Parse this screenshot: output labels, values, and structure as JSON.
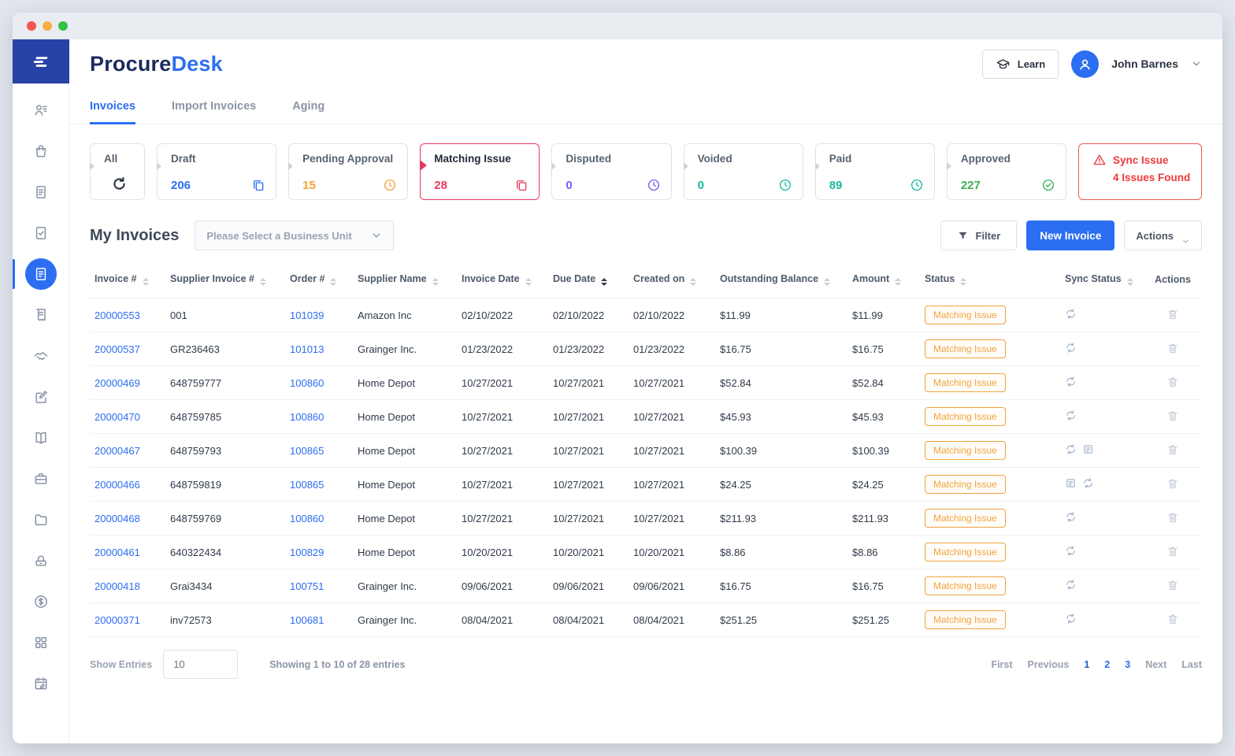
{
  "colors": {
    "accent_blue": "#2c6ef2",
    "badge_orange": "#f2a23c",
    "alert_red": "#ee3b3b",
    "selected_pink": "#e8395f",
    "sidebar_logo_bg": "#2742a6",
    "traffic_lights": [
      "#f4564e",
      "#f5b041",
      "#33c148"
    ]
  },
  "brand": {
    "logo_part1": "Procure",
    "logo_part2": "Desk"
  },
  "header": {
    "learn_label": "Learn",
    "user_name": "John Barnes"
  },
  "sidebar": {
    "items": [
      {
        "icon": "users-icon",
        "active": false
      },
      {
        "icon": "shopping-bag-icon",
        "active": false
      },
      {
        "icon": "purchase-order-icon",
        "active": false
      },
      {
        "icon": "document-check-icon",
        "active": false
      },
      {
        "icon": "invoices-icon",
        "active": true
      },
      {
        "icon": "receipt-icon",
        "active": false
      },
      {
        "icon": "handshake-icon",
        "active": false
      },
      {
        "icon": "document-edit-icon",
        "active": false
      },
      {
        "icon": "catalog-icon",
        "active": false
      },
      {
        "icon": "toolbox-icon",
        "active": false
      },
      {
        "icon": "folder-icon",
        "active": false
      },
      {
        "icon": "scale-icon",
        "active": false
      },
      {
        "icon": "currency-icon",
        "active": false
      },
      {
        "icon": "apps-grid-icon",
        "active": false
      },
      {
        "icon": "calendar-edit-icon",
        "active": false
      }
    ]
  },
  "tabs": [
    {
      "label": "Invoices",
      "active": true
    },
    {
      "label": "Import Invoices",
      "active": false
    },
    {
      "label": "Aging",
      "active": false
    }
  ],
  "status_cards": [
    {
      "label": "All",
      "type": "all",
      "icon": "refresh-icon",
      "color": "#2b3440"
    },
    {
      "label": "Draft",
      "count": "206",
      "icon": "copy-icon",
      "color": "#2c6ef2"
    },
    {
      "label": "Pending Approval",
      "count": "15",
      "icon": "clock-icon",
      "color": "#f2a23c"
    },
    {
      "label": "Matching Issue",
      "count": "28",
      "icon": "copy-icon",
      "color": "#e8395f",
      "selected": true
    },
    {
      "label": "Disputed",
      "count": "0",
      "icon": "clock-icon",
      "color": "#7a5af8"
    },
    {
      "label": "Voided",
      "count": "0",
      "icon": "clock-icon",
      "color": "#1db9a0"
    },
    {
      "label": "Paid",
      "count": "89",
      "icon": "clock-icon",
      "color": "#1db9a0"
    },
    {
      "label": "Approved",
      "count": "227",
      "icon": "check-circle-icon",
      "color": "#3bb059"
    },
    {
      "label": "Sync Issue",
      "type": "alert",
      "sub": "4 Issues Found",
      "icon": "warning-icon",
      "color": "#ee3b3b"
    }
  ],
  "toolbar": {
    "title": "My Invoices",
    "business_unit_placeholder": "Please Select a Business Unit",
    "filter_label": "Filter",
    "new_invoice_label": "New Invoice",
    "actions_label": "Actions"
  },
  "table": {
    "columns": [
      {
        "label": "Invoice #",
        "sortable": true,
        "sorted": false
      },
      {
        "label": "Supplier Invoice #",
        "sortable": true,
        "sorted": false
      },
      {
        "label": "Order #",
        "sortable": true,
        "sorted": false
      },
      {
        "label": "Supplier Name",
        "sortable": true,
        "sorted": false
      },
      {
        "label": "Invoice Date",
        "sortable": true,
        "sorted": false
      },
      {
        "label": "Due Date",
        "sortable": true,
        "sorted": true
      },
      {
        "label": "Created on",
        "sortable": true,
        "sorted": false
      },
      {
        "label": "Outstanding Balance",
        "sortable": true,
        "sorted": false
      },
      {
        "label": "Amount",
        "sortable": true,
        "sorted": false
      },
      {
        "label": "Status",
        "sortable": true,
        "sorted": false
      },
      {
        "label": "Sync Status",
        "sortable": true,
        "sorted": false
      },
      {
        "label": "Actions",
        "sortable": false,
        "sorted": false
      }
    ],
    "rows": [
      {
        "invoice": "20000553",
        "supplier_invoice": "001",
        "order": "101039",
        "supplier": "Amazon Inc",
        "invoice_date": "02/10/2022",
        "due_date": "02/10/2022",
        "created_on": "02/10/2022",
        "outstanding": "$11.99",
        "amount": "$11.99",
        "status": "Matching Issue",
        "sync_icons": [
          "sync"
        ]
      },
      {
        "invoice": "20000537",
        "supplier_invoice": "GR236463",
        "order": "101013",
        "supplier": "Grainger Inc.",
        "invoice_date": "01/23/2022",
        "due_date": "01/23/2022",
        "created_on": "01/23/2022",
        "outstanding": "$16.75",
        "amount": "$16.75",
        "status": "Matching Issue",
        "sync_icons": [
          "sync"
        ]
      },
      {
        "invoice": "20000469",
        "supplier_invoice": "648759777",
        "order": "100860",
        "supplier": "Home Depot",
        "invoice_date": "10/27/2021",
        "due_date": "10/27/2021",
        "created_on": "10/27/2021",
        "outstanding": "$52.84",
        "amount": "$52.84",
        "status": "Matching Issue",
        "sync_icons": [
          "sync"
        ]
      },
      {
        "invoice": "20000470",
        "supplier_invoice": "648759785",
        "order": "100860",
        "supplier": "Home Depot",
        "invoice_date": "10/27/2021",
        "due_date": "10/27/2021",
        "created_on": "10/27/2021",
        "outstanding": "$45.93",
        "amount": "$45.93",
        "status": "Matching Issue",
        "sync_icons": [
          "sync"
        ]
      },
      {
        "invoice": "20000467",
        "supplier_invoice": "648759793",
        "order": "100865",
        "supplier": "Home Depot",
        "invoice_date": "10/27/2021",
        "due_date": "10/27/2021",
        "created_on": "10/27/2021",
        "outstanding": "$100.39",
        "amount": "$100.39",
        "status": "Matching Issue",
        "sync_icons": [
          "sync",
          "document"
        ]
      },
      {
        "invoice": "20000466",
        "supplier_invoice": "648759819",
        "order": "100865",
        "supplier": "Home Depot",
        "invoice_date": "10/27/2021",
        "due_date": "10/27/2021",
        "created_on": "10/27/2021",
        "outstanding": "$24.25",
        "amount": "$24.25",
        "status": "Matching Issue",
        "sync_icons": [
          "document",
          "sync"
        ]
      },
      {
        "invoice": "20000468",
        "supplier_invoice": "648759769",
        "order": "100860",
        "supplier": "Home Depot",
        "invoice_date": "10/27/2021",
        "due_date": "10/27/2021",
        "created_on": "10/27/2021",
        "outstanding": "$211.93",
        "amount": "$211.93",
        "status": "Matching Issue",
        "sync_icons": [
          "sync"
        ]
      },
      {
        "invoice": "20000461",
        "supplier_invoice": "640322434",
        "order": "100829",
        "supplier": "Home Depot",
        "invoice_date": "10/20/2021",
        "due_date": "10/20/2021",
        "created_on": "10/20/2021",
        "outstanding": "$8.86",
        "amount": "$8.86",
        "status": "Matching Issue",
        "sync_icons": [
          "sync"
        ]
      },
      {
        "invoice": "20000418",
        "supplier_invoice": "Grai3434",
        "order": "100751",
        "supplier": "Grainger Inc.",
        "invoice_date": "09/06/2021",
        "due_date": "09/06/2021",
        "created_on": "09/06/2021",
        "outstanding": "$16.75",
        "amount": "$16.75",
        "status": "Matching Issue",
        "sync_icons": [
          "sync"
        ]
      },
      {
        "invoice": "20000371",
        "supplier_invoice": "inv72573",
        "order": "100681",
        "supplier": "Grainger Inc.",
        "invoice_date": "08/04/2021",
        "due_date": "08/04/2021",
        "created_on": "08/04/2021",
        "outstanding": "$251.25",
        "amount": "$251.25",
        "status": "Matching Issue",
        "sync_icons": [
          "sync"
        ]
      }
    ]
  },
  "footer": {
    "show_entries_label": "Show Entries",
    "entries_value": "10",
    "summary": "Showing 1 to 10 of 28 entries",
    "pagination": [
      {
        "label": "First",
        "type": "nav",
        "active": false
      },
      {
        "label": "Previous",
        "type": "nav",
        "active": false
      },
      {
        "label": "1",
        "type": "num",
        "active": true
      },
      {
        "label": "2",
        "type": "num",
        "active": false
      },
      {
        "label": "3",
        "type": "num",
        "active": false
      },
      {
        "label": "Next",
        "type": "nav",
        "active": false
      },
      {
        "label": "Last",
        "type": "nav",
        "active": false
      }
    ]
  }
}
